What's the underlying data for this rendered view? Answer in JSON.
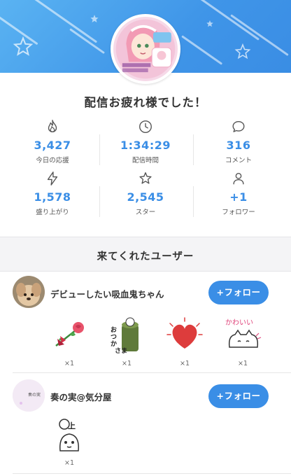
{
  "header": {
    "title": "配信お疲れ様でした！",
    "avatar_icon": "streamer-avatar-icon"
  },
  "stats": [
    {
      "icon": "flame-icon",
      "value": "3,427",
      "label": "今日の応援"
    },
    {
      "icon": "clock-icon",
      "value": "1:34:29",
      "label": "配信時間"
    },
    {
      "icon": "comment-icon",
      "value": "316",
      "label": "コメント"
    },
    {
      "icon": "lightning-icon",
      "value": "1,578",
      "label": "盛り上がり"
    },
    {
      "icon": "star-icon",
      "value": "2,545",
      "label": "スター"
    },
    {
      "icon": "person-icon",
      "value": "+1",
      "label": "フォロワー"
    }
  ],
  "visitors": {
    "section_title": "来てくれたユーザー",
    "users": [
      {
        "name": "デビューしたい吸血鬼ちゃん",
        "follow_label": "+フォロー",
        "gifts": [
          {
            "icon": "rose-icon",
            "count": "×1"
          },
          {
            "icon": "otsukaresama-icon",
            "count": "×1"
          },
          {
            "icon": "heart-icon",
            "count": "×1"
          },
          {
            "icon": "kawaii-cat-icon",
            "count": "×1"
          }
        ]
      },
      {
        "name": "奏の実@気分屋",
        "follow_label": "+フォロー",
        "gifts": [
          {
            "icon": "hedgehog-icon",
            "count": "×1"
          }
        ]
      }
    ]
  },
  "colors": {
    "accent": "#3a8ee6",
    "banner": "#4a9fec"
  }
}
